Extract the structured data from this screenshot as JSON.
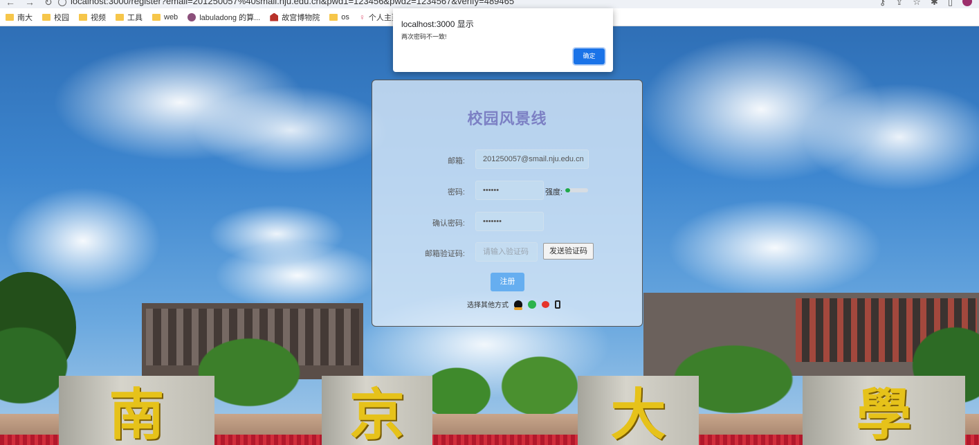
{
  "browser": {
    "url": "localhost:3000/register?email=201250057%40smail.nju.edu.cn&pwd1=123456&pwd2=1234567&verify=489465"
  },
  "bookmarks": [
    {
      "label": "南大",
      "icon": "folder-icon"
    },
    {
      "label": "校园",
      "icon": "folder-icon"
    },
    {
      "label": "视频",
      "icon": "folder-icon"
    },
    {
      "label": "工具",
      "icon": "folder-icon"
    },
    {
      "label": "web",
      "icon": "folder-icon"
    },
    {
      "label": "labuladong 的算...",
      "icon": "site-icon"
    },
    {
      "label": "故宫博物院",
      "icon": "museum-icon"
    },
    {
      "label": "os",
      "icon": "folder-icon"
    },
    {
      "label": "个人主页",
      "icon": "person-icon"
    }
  ],
  "dialog": {
    "title": "localhost:3000 显示",
    "message": "两次密码不一致!",
    "ok_label": "确定"
  },
  "card": {
    "title": "校园风景线",
    "email_label": "邮箱:",
    "email_value": "201250057@smail.nju.edu.cn",
    "password_label": "密码:",
    "password_value": "••••••",
    "strength_label": "强度:",
    "strength_level": 0.2,
    "strength_color": "#1ea84a",
    "confirm_label": "确认密码:",
    "confirm_value": "•••••••",
    "code_label": "邮箱验证码:",
    "code_placeholder": "请输入验证码",
    "send_code_label": "发送验证码",
    "register_label": "注册",
    "others_label": "选择其他方式",
    "social_icons": [
      "qq-icon",
      "wechat-icon",
      "weibo-icon",
      "phone-icon"
    ]
  },
  "scene": {
    "stone_characters": [
      "南",
      "京",
      "大",
      "學"
    ]
  }
}
